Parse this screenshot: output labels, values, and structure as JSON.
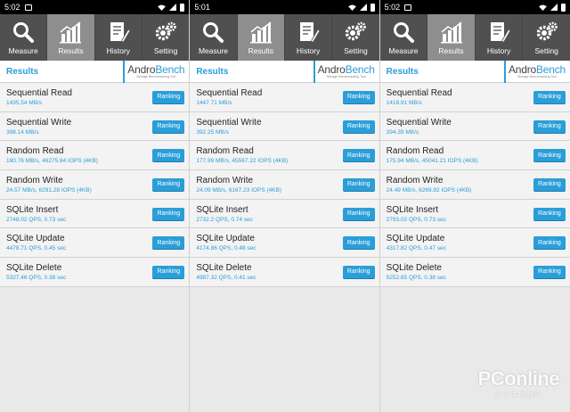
{
  "tabs": [
    {
      "label": "Measure",
      "icon": "magnifier-icon",
      "active": false
    },
    {
      "label": "Results",
      "icon": "bar-chart-icon",
      "active": true
    },
    {
      "label": "History",
      "icon": "document-pen-icon",
      "active": false
    },
    {
      "label": "Setting",
      "icon": "gears-icon",
      "active": false
    }
  ],
  "results_title": "Results",
  "logo": {
    "andro": "Andro",
    "bench": "Bench",
    "tagline": "Storage Benchmarking Tool"
  },
  "ranking_label": "Ranking",
  "accent_color": "#2a9ed8",
  "panels": [
    {
      "time": "5:02",
      "rows": [
        {
          "name": "Sequential Read",
          "value": "1435.54 MB/s"
        },
        {
          "name": "Sequential Write",
          "value": "398.14 MB/s"
        },
        {
          "name": "Random Read",
          "value": "180.76 MB/s, 46275.84 IOPS (4KB)"
        },
        {
          "name": "Random Write",
          "value": "24.57 MB/s, 6291.28 IOPS (4KB)"
        },
        {
          "name": "SQLite Insert",
          "value": "2748.02 QPS, 0.73 sec"
        },
        {
          "name": "SQLite Update",
          "value": "4478.71 QPS, 0.45 sec"
        },
        {
          "name": "SQLite Delete",
          "value": "5327.46 QPS, 0.38 sec"
        }
      ]
    },
    {
      "time": "5:01",
      "rows": [
        {
          "name": "Sequential Read",
          "value": "1447.71 MB/s"
        },
        {
          "name": "Sequential Write",
          "value": "392.25 MB/s"
        },
        {
          "name": "Random Read",
          "value": "177.99 MB/s, 45567.22 IOPS (4KB)"
        },
        {
          "name": "Random Write",
          "value": "24.09 MB/s, 6167.23 IOPS (4KB)"
        },
        {
          "name": "SQLite Insert",
          "value": "2732.2 QPS, 0.74 sec"
        },
        {
          "name": "SQLite Update",
          "value": "4174.86 QPS, 0.48 sec"
        },
        {
          "name": "SQLite Delete",
          "value": "4987.32 QPS, 0.41 sec"
        }
      ]
    },
    {
      "time": "5:02",
      "rows": [
        {
          "name": "Sequential Read",
          "value": "1418.91 MB/s"
        },
        {
          "name": "Sequential Write",
          "value": "394.39 MB/s"
        },
        {
          "name": "Random Read",
          "value": "175.94 MB/s, 45041.21 IOPS (4KB)"
        },
        {
          "name": "Random Write",
          "value": "24.49 MB/s, 6269.92 IOPS (4KB)"
        },
        {
          "name": "SQLite Insert",
          "value": "2793.02 QPS, 0.73 sec"
        },
        {
          "name": "SQLite Update",
          "value": "4317.82 QPS, 0.47 sec"
        },
        {
          "name": "SQLite Delete",
          "value": "5252.65 QPS, 0.38 sec"
        }
      ]
    }
  ],
  "watermark": {
    "text": "PConline",
    "sub": "太平洋电脑网"
  }
}
